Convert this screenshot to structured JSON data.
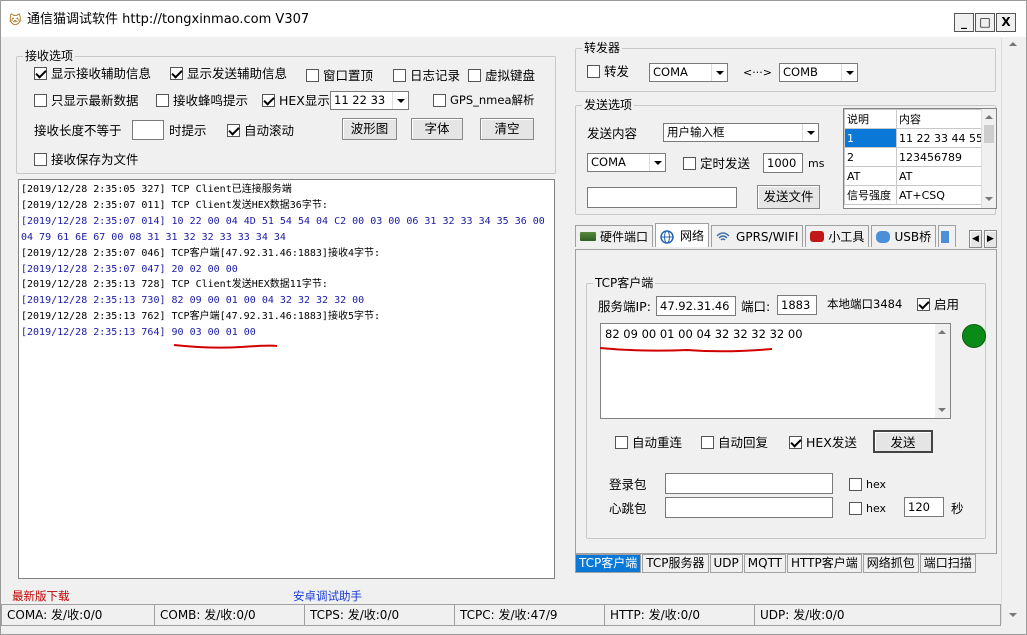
{
  "window": {
    "title": "通信猫调试软件  http://tongxinmao.com  V307",
    "minimize": "_",
    "maximize": "□",
    "close": "X"
  },
  "receive_options": {
    "group_label": "接收选项",
    "show_rx_info": "显示接收辅助信息",
    "show_tx_info": "显示发送辅助信息",
    "window_top": "窗口置顶",
    "log_record": "日志记录",
    "virtual_keyboard": "虚拟键盘",
    "latest_only": "只显示最新数据",
    "beep": "接收蜂鸣提示",
    "hex_display": "HEX显示",
    "hex_sample": "11 22 33",
    "gps_parse": "GPS_nmea解析",
    "length_label": "接收长度不等于",
    "length_value": "",
    "prompt_label": "时提示",
    "auto_scroll": "自动滚动",
    "waveform_btn": "波形图",
    "font_btn": "字体",
    "clear_btn": "清空",
    "save_to_file": "接收保存为文件"
  },
  "log": [
    {
      "t": "[2019/12/28 2:35:05 327]",
      "msg": " TCP Client已连接服务端",
      "hex": false
    },
    {
      "t": "[2019/12/28 2:35:07 011]",
      "msg": " TCP Client发送HEX数据36字节:",
      "hex": false
    },
    {
      "t": "[2019/12/28 2:35:07 014]",
      "msg": " 10 22 00 04 4D 51 54 54 04 C2 00 03 00 06 31 32 33 34 35 36 00",
      "hex": true
    },
    {
      "t": "",
      "msg": "04 79 61 6E 67 00 08 31 31 32 32 33 33 34 34",
      "hex": true
    },
    {
      "t": "[2019/12/28 2:35:07 046]",
      "msg": " TCP客户端[47.92.31.46:1883]接收4字节:",
      "hex": false
    },
    {
      "t": "[2019/12/28 2:35:07 047]",
      "msg": " 20 02 00 00",
      "hex": true
    },
    {
      "t": "[2019/12/28 2:35:13 728]",
      "msg": " TCP Client发送HEX数据11字节:",
      "hex": false
    },
    {
      "t": "[2019/12/28 2:35:13 730]",
      "msg": " 82 09 00 01 00 04 32 32 32 32 00",
      "hex": true
    },
    {
      "t": "[2019/12/28 2:35:13 762]",
      "msg": " TCP客户端[47.92.31.46:1883]接收5字节:",
      "hex": false
    },
    {
      "t": "[2019/12/28 2:35:13 764]",
      "msg": " 90 03 00 01 00",
      "hex": true
    }
  ],
  "forwarder": {
    "group_label": "转发器",
    "forward_label": "转发",
    "src": "COMA",
    "arrow": "<···>",
    "dst": "COMB"
  },
  "send_options": {
    "group_label": "发送选项",
    "content_label": "发送内容",
    "content_mode": "用户输入框",
    "port": "COMA",
    "timed_send": "定时发送",
    "interval": "1000",
    "interval_unit": "ms",
    "file_path": "",
    "send_file_btn": "发送文件",
    "table_headers": [
      "说明",
      "内容"
    ],
    "table_rows": [
      [
        "1",
        "11 22 33 44 55"
      ],
      [
        "2",
        "123456789"
      ],
      [
        "AT",
        "AT"
      ],
      [
        "信号强度",
        "AT+CSQ"
      ]
    ]
  },
  "tabs": [
    "硬件端口",
    "网络",
    "GPRS/WIFI",
    "小工具",
    "USB桥"
  ],
  "tcp_client": {
    "group_label": "TCP客户端",
    "server_ip_label": "服务端IP:",
    "server_ip": "47.92.31.46",
    "port_label": "端口:",
    "port": "1883",
    "local_port_label": "本地端口3484",
    "enable_label": "启用",
    "send_text": "82 09 00 01 00 04 32 32 32 32 00",
    "status_color": "#0a8a16",
    "auto_reconnect": "自动重连",
    "auto_reply": "自动回复",
    "hex_send": "HEX发送",
    "send_btn": "发送",
    "login_label": "登录包",
    "login_value": "",
    "heartbeat_label": "心跳包",
    "heartbeat_value": "",
    "hex_label": "hex",
    "heartbeat_interval": "120",
    "seconds": "秒"
  },
  "bottom_tabs": [
    "TCP客户端",
    "TCP服务器",
    "UDP",
    "MQTT",
    "HTTP客户端",
    "网络抓包",
    "端口扫描"
  ],
  "links": {
    "latest_download": "最新版下载",
    "android_helper": "安卓调试助手"
  },
  "status_bar": [
    "COMA: 发/收:0/0",
    "COMB: 发/收:0/0",
    "TCPS: 发/收:0/0",
    "TCPC: 发/收:47/9",
    "HTTP: 发/收:0/0",
    "UDP: 发/收:0/0"
  ],
  "colors": {
    "accent": "#0a78d7",
    "link_red": "#c00000",
    "link_blue": "#1a3bd6",
    "hex_text": "#1a1aa6",
    "annotation": "#d00000"
  }
}
